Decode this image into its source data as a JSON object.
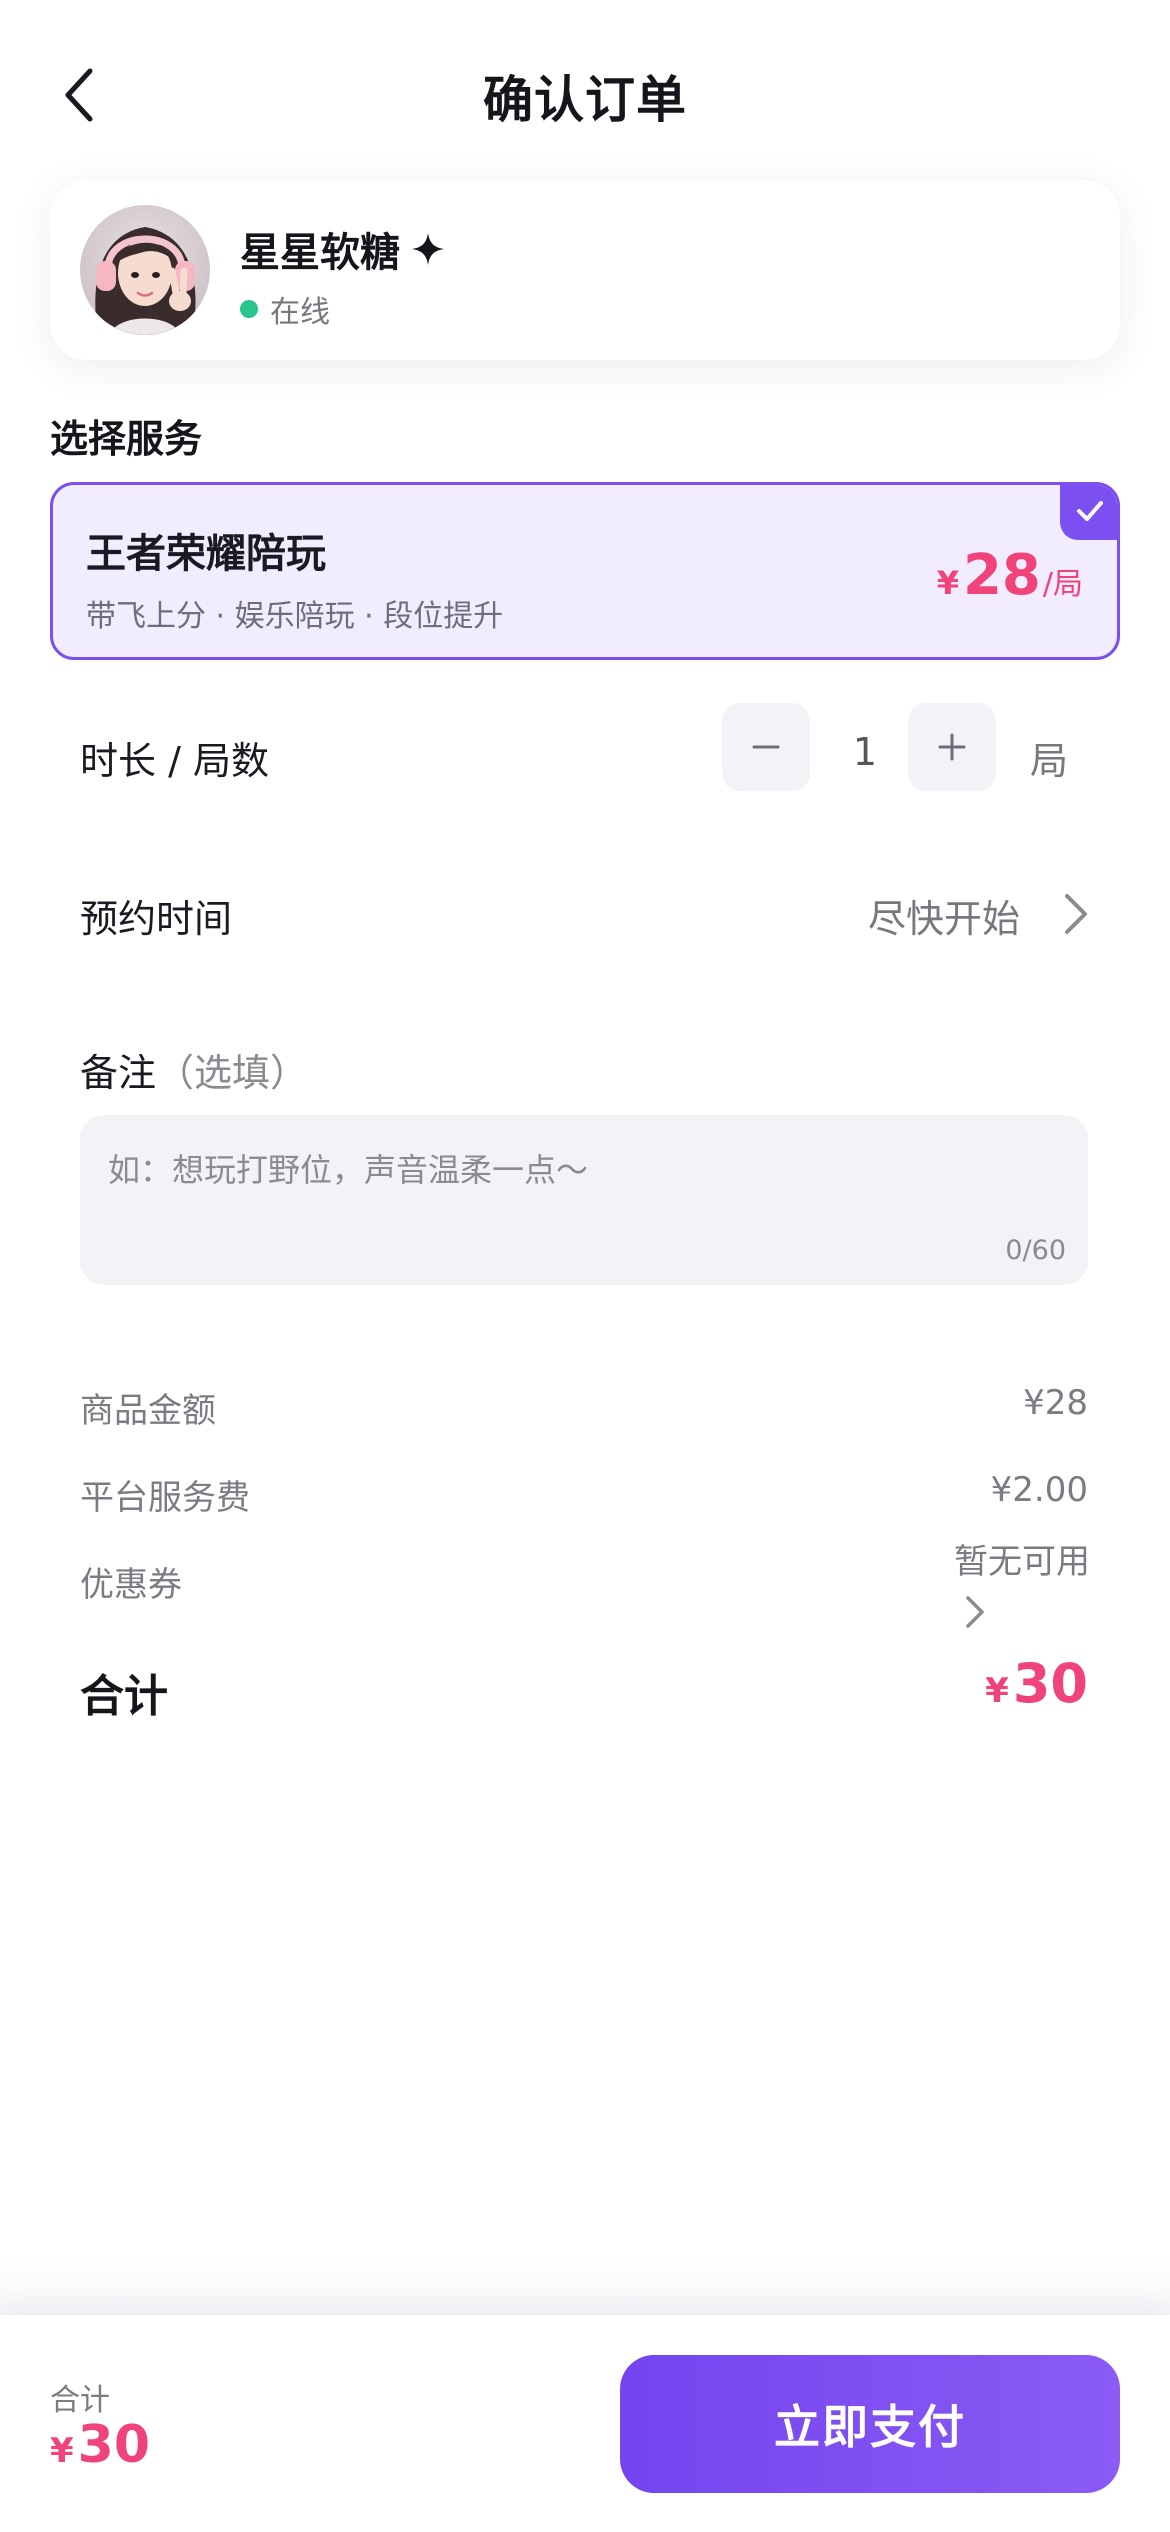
{
  "header": {
    "title": "确认订单",
    "back_icon": "chevron-left-icon"
  },
  "companion": {
    "name": "星星软糖",
    "badge_icon": "sparkle-icon",
    "status": "在线",
    "status_color": "#2bc48a"
  },
  "service_section": {
    "title": "选择服务",
    "selected_service": {
      "name": "王者荣耀陪玩",
      "description": "带飞上分 · 娱乐陪玩 · 段位提升",
      "currency": "¥",
      "price": "28",
      "unit": "/局",
      "selected": true,
      "check_icon": "check-icon"
    }
  },
  "duration": {
    "label": "时长 / 局数",
    "minus_icon": "minus-icon",
    "plus_icon": "plus-icon",
    "quantity": "1",
    "unit": "局"
  },
  "schedule": {
    "label": "预约时间",
    "value": "尽快开始",
    "chevron_icon": "chevron-right-icon"
  },
  "note": {
    "label": "备注",
    "optional": "（选填）",
    "placeholder": "如：想玩打野位，声音温柔一点～",
    "value": "",
    "count": "0/60"
  },
  "summary": {
    "subtotal_label": "商品金额",
    "subtotal_value": "¥28",
    "service_fee_label": "平台服务费",
    "service_fee_value": "¥2.00",
    "coupon_label": "优惠券",
    "coupon_value": "暂无可用",
    "total_label": "合计",
    "total_currency": "¥",
    "total_value": "30"
  },
  "bottom_bar": {
    "total_label": "合计",
    "currency": "¥",
    "total_value": "30",
    "pay_label": "立即支付"
  },
  "colors": {
    "accent": "#7b4ff0",
    "price": "#f0437a",
    "selected_bg": "#f1ecfe",
    "online": "#2bc48a"
  }
}
